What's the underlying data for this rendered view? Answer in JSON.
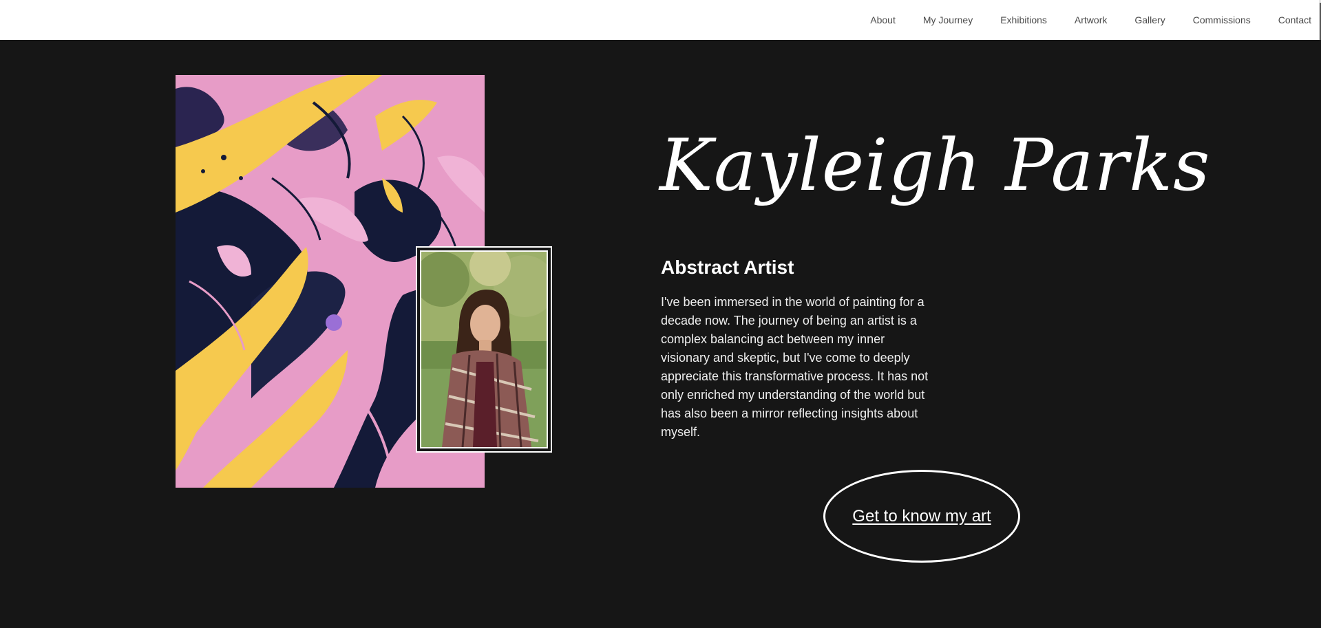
{
  "nav": {
    "items": [
      "About",
      "My Journey",
      "Exhibitions",
      "Artwork",
      "Gallery",
      "Commissions",
      "Contact"
    ]
  },
  "hero": {
    "title": "Kayleigh Parks",
    "subtitle": "Abstract Artist",
    "bio": "I've been immersed in the world of painting for a decade now. The journey of being an artist is a complex balancing act between my inner visionary and skeptic, but I've come to deeply appreciate this transformative process. It has not only enriched my understanding of the world but has also been a mirror reflecting insights about myself.",
    "cta_label": "Get to know my art"
  },
  "colors": {
    "background": "#161616",
    "header": "#ffffff",
    "nav_text": "#4a4a4a",
    "text": "#ffffff",
    "paint_pink": "#e79cc7",
    "paint_yellow": "#f6c94e",
    "paint_navy": "#141a38"
  }
}
